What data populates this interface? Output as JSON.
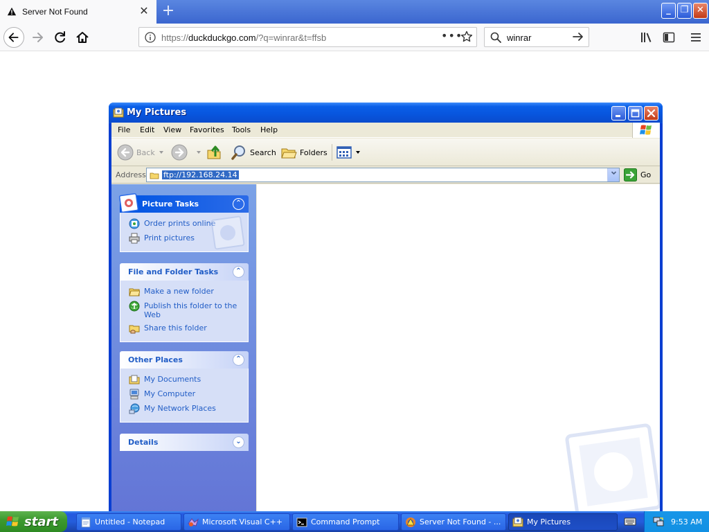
{
  "firefox": {
    "tab": {
      "title": "Server Not Found",
      "close_symbol": "✕"
    },
    "new_tab_symbol": "+",
    "window_controls": {
      "minimize": "_",
      "maximize": "❐",
      "close": "✕"
    },
    "urlbar": {
      "scheme": "https://",
      "host": "duckduckgo.com",
      "path": "/?q=winrar&t=ffsb",
      "overflow": "•••"
    },
    "searchbar": {
      "value": "winrar"
    }
  },
  "explorer": {
    "title": "My Pictures",
    "menu": [
      "File",
      "Edit",
      "View",
      "Favorites",
      "Tools",
      "Help"
    ],
    "toolbar": {
      "back": "Back",
      "search": "Search",
      "folders": "Folders"
    },
    "address": {
      "label": "Address",
      "value": "ftp://192.168.24.14",
      "go": "Go"
    },
    "task_pane": {
      "picture_tasks": {
        "title": "Picture Tasks",
        "items": [
          "Order prints online",
          "Print pictures"
        ]
      },
      "file_folder_tasks": {
        "title": "File and Folder Tasks",
        "items": [
          "Make a new folder",
          "Publish this folder to the Web",
          "Share this folder"
        ]
      },
      "other_places": {
        "title": "Other Places",
        "items": [
          "My Documents",
          "My Computer",
          "My Network Places"
        ]
      },
      "details": {
        "title": "Details"
      }
    }
  },
  "taskbar": {
    "start": "start",
    "buttons": [
      "Untitled - Notepad",
      "Microsoft Visual C++",
      "Command Prompt",
      "Server Not Found - ...",
      "My Pictures"
    ],
    "clock": "9:53 AM"
  },
  "colors": {
    "xp_title_blue": "#0a5fe8",
    "task_pane_blue": "#7ba2e7",
    "start_green": "#3d9a2f",
    "link_blue": "#215dc6"
  }
}
